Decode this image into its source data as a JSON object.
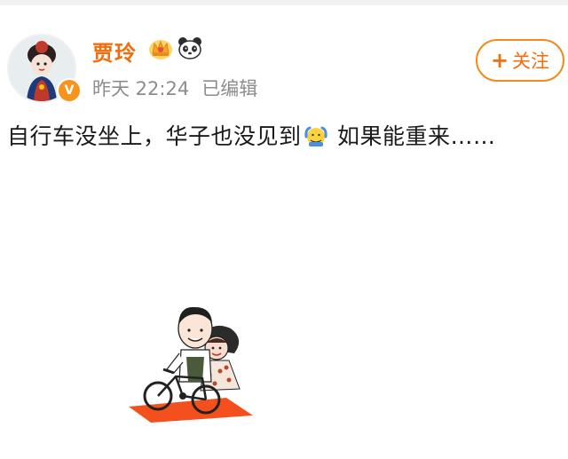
{
  "user": {
    "name": "贾玲",
    "verified_badge": "V"
  },
  "post_meta": {
    "time": "昨天 22:24",
    "edited": "已编辑"
  },
  "follow_button": {
    "plus": "+",
    "label": "关注"
  },
  "post": {
    "text_before_emoji": "自行车没坐上，华子也没见到",
    "emoji_name": "hands-up-emoji",
    "text_after_emoji": " 如果能重来……"
  },
  "icons": {
    "crown": "crown-icon",
    "panda": "panda-icon"
  },
  "colors": {
    "name": "#f26d0e",
    "accent": "#f28b1e",
    "meta": "#8c8c8c",
    "text": "#1a1a1a"
  }
}
